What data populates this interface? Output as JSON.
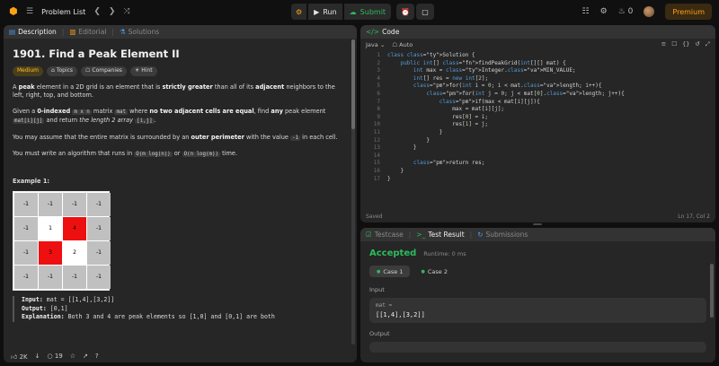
{
  "topbar": {
    "title": "Problem List",
    "run": "Run",
    "submit": "Submit",
    "streak": "0",
    "premium": "Premium"
  },
  "left_tabs": {
    "description": "Description",
    "editorial": "Editorial",
    "solutions": "Solutions"
  },
  "problem": {
    "title": "1901. Find a Peak Element II",
    "difficulty": "Medium",
    "topics": "Topics",
    "companies": "Companies",
    "hint": "Hint",
    "p1": {
      "a": "A ",
      "b": "peak",
      "c": " element in a 2D grid is an element that is ",
      "d": "strictly greater",
      "e": " than all of its ",
      "f": "adjacent",
      "g": " neighbors to the left, right, top, and bottom."
    },
    "p2": {
      "a": "Given a ",
      "b": "0-indexed",
      "c": " ",
      "d": "m x n",
      "e": " matrix ",
      "f": "mat",
      "g": " where ",
      "h": "no two adjacent cells are equal",
      "i": ", find ",
      "j": "any",
      "k": " peak element ",
      "l": "mat[i][j]",
      "m": " and return ",
      "n": "the length 2 array",
      "o": " ",
      "p": "[i,j]",
      "q": "."
    },
    "p3": {
      "a": "You may assume that the entire matrix is surrounded by an ",
      "b": "outer perimeter",
      "c": " with the value ",
      "d": "-1",
      "e": " in each cell."
    },
    "p4": {
      "a": "You must write an algorithm that runs in ",
      "b": "O(m log(n))",
      "c": " or ",
      "d": "O(n log(m))",
      "e": " time."
    },
    "example_title": "Example 1:",
    "grid": [
      [
        "-1",
        "-1",
        "-1",
        "-1"
      ],
      [
        "-1",
        "1",
        "4",
        "-1"
      ],
      [
        "-1",
        "3",
        "2",
        "-1"
      ],
      [
        "-1",
        "-1",
        "-1",
        "-1"
      ]
    ],
    "ex_input_label": "Input:",
    "ex_input": " mat = [[1,4],[3,2]]",
    "ex_output_label": "Output:",
    "ex_output": " [0,1]",
    "ex_expl_label": "Explanation:",
    "ex_expl": " Both 3 and 4 are peak elements so [1,0] and [0,1] are both"
  },
  "footer": {
    "likes": "2K",
    "comments": "19"
  },
  "code_panel": {
    "tab": "Code",
    "language": "Java",
    "auto": "Auto",
    "status_left": "Saved",
    "status_right": "Ln 17, Col 2"
  },
  "code_lines": [
    "class Solution {",
    "    public int[] findPeakGrid(int[][] mat) {",
    "        int max = Integer.MIN_VALUE;",
    "        int[] res = new int[2];",
    "        for(int i = 0; i < mat.length; i++){",
    "            for(int j = 0; j < mat[0].length; j++){",
    "                if(max < mat[i][j]){",
    "                    max = mat[i][j];",
    "                    res[0] = i;",
    "                    res[1] = j;",
    "                }",
    "            }",
    "        }",
    "",
    "        return res;",
    "    }",
    "}"
  ],
  "test_panel": {
    "testcase": "Testcase",
    "test_result": "Test Result",
    "submissions": "Submissions",
    "accepted": "Accepted",
    "runtime": "Runtime: 0 ms",
    "case1": "Case 1",
    "case2": "Case 2",
    "input_label": "Input",
    "var_name": "mat =",
    "var_value": "[[1,4],[3,2]]",
    "output_label": "Output"
  },
  "colors": {
    "accent": "#ffa116",
    "green": "#2cbb5d",
    "peak": "#ee1010"
  }
}
